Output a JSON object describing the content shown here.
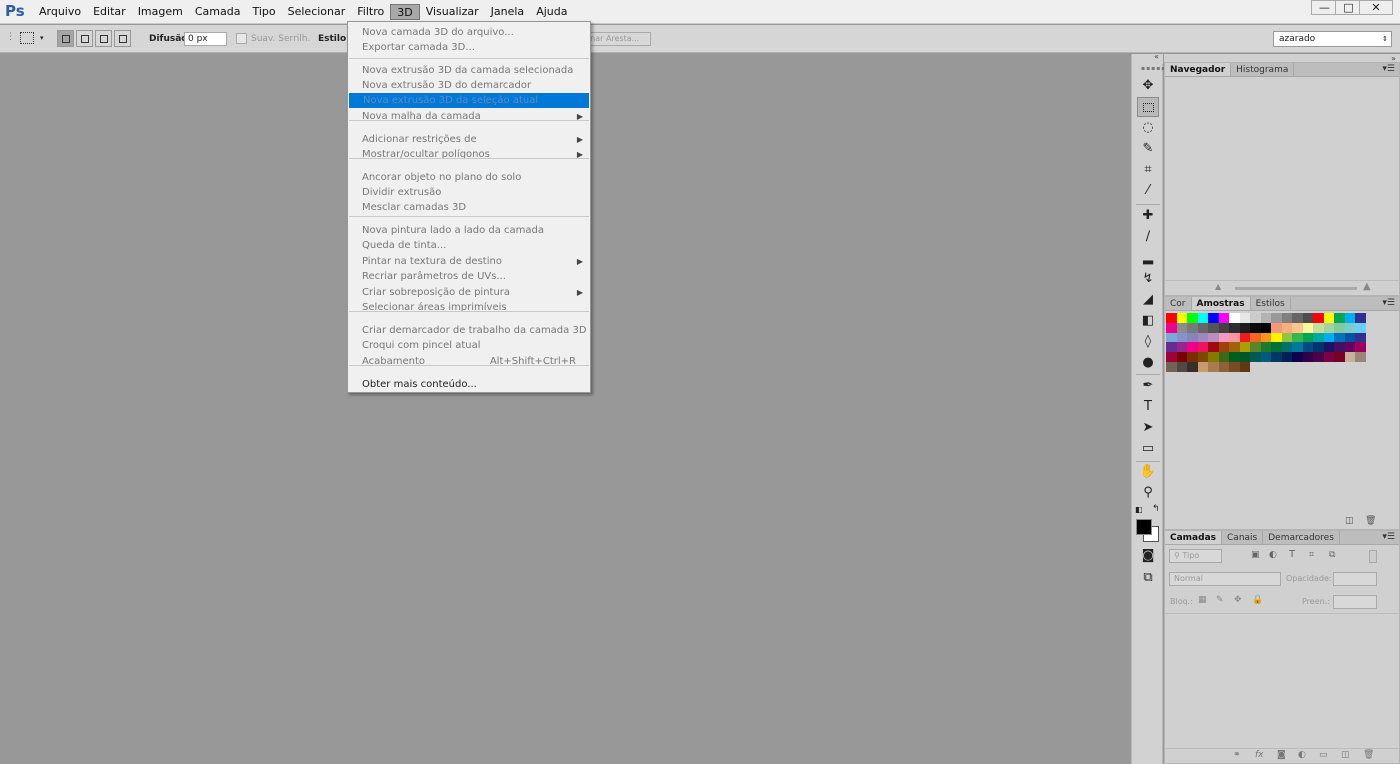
{
  "app": {
    "logo": "Ps"
  },
  "menubar": {
    "items": [
      "Arquivo",
      "Editar",
      "Imagem",
      "Camada",
      "Tipo",
      "Selecionar",
      "Filtro",
      "3D",
      "Visualizar",
      "Janela",
      "Ajuda"
    ],
    "active_index": 7
  },
  "window_controls": {
    "minimize": "—",
    "maximize": "□",
    "close": "✕"
  },
  "options": {
    "feather_label": "Difusão:",
    "feather_value": "0 px",
    "antialias_label": "Suav. Serrilh.",
    "style_label": "Estilo:",
    "refine_edge": "Refinar Aresta...",
    "workspace_value": "azarado"
  },
  "menu_3d": {
    "items": [
      {
        "label": "Nova camada 3D do arquivo...",
        "enabled": false
      },
      {
        "label": "Exportar camada 3D...",
        "enabled": false
      },
      {
        "label": "Nova extrusão 3D da camada selecionada",
        "enabled": false
      },
      {
        "label": "Nova extrusão 3D do demarcador selecionado",
        "enabled": false
      },
      {
        "label": "Nova extrusão 3D da seleção atual",
        "enabled": false,
        "highlighted": true
      },
      {
        "label": "Nova malha da camada",
        "enabled": false,
        "submenu": true
      },
      {
        "label": "Adicionar restrições de",
        "enabled": false,
        "submenu": true
      },
      {
        "label": "Mostrar/ocultar polígonos",
        "enabled": false,
        "submenu": true
      },
      {
        "label": "Ancorar objeto no plano do solo",
        "enabled": false
      },
      {
        "label": "Dividir extrusão",
        "enabled": false
      },
      {
        "label": "Mesclar camadas 3D",
        "enabled": false
      },
      {
        "label": "Nova pintura lado a lado da camada",
        "enabled": false
      },
      {
        "label": "Queda de tinta...",
        "enabled": false
      },
      {
        "label": "Pintar na textura de destino",
        "enabled": false,
        "submenu": true
      },
      {
        "label": "Recriar parâmetros de UVs...",
        "enabled": false
      },
      {
        "label": "Criar sobreposição de pintura",
        "enabled": false,
        "submenu": true
      },
      {
        "label": "Selecionar áreas imprimíveis",
        "enabled": false
      },
      {
        "label": "Criar demarcador de trabalho da camada 3D",
        "enabled": false
      },
      {
        "label": "Croqui com pincel atual",
        "enabled": false
      },
      {
        "label": "Acabamento",
        "enabled": false,
        "shortcut": "Alt+Shift+Ctrl+R"
      },
      {
        "label": "Obter mais conteúdo...",
        "enabled": true
      }
    ]
  },
  "panels": {
    "navigator": {
      "tabs": [
        "Navegador",
        "Histograma"
      ]
    },
    "swatches": {
      "tabs": [
        "Cor",
        "Amostras",
        "Estilos"
      ],
      "colors": [
        "#ff0000",
        "#ffff00",
        "#00ff00",
        "#00ffff",
        "#0000ff",
        "#ff00ff",
        "#ffffff",
        "#e6e6e6",
        "#cccccc",
        "#b3b3b3",
        "#999999",
        "#808080",
        "#666666",
        "#4d4d4d",
        "#ff0000",
        "#ffff00",
        "#00a651",
        "#00aeef",
        "#2e3192",
        "#ec008c",
        "#8c8c8c",
        "#7a7a7a",
        "#666666",
        "#545454",
        "#424242",
        "#2e2e2e",
        "#1c1c1c",
        "#0a0a0a",
        "#000000",
        "#f7977a",
        "#f9ad81",
        "#fdc68a",
        "#fff79a",
        "#c4df9b",
        "#a3d39c",
        "#82ca9d",
        "#7bcdc8",
        "#6ecff6",
        "#7ea7d8",
        "#8493ca",
        "#8882be",
        "#a187be",
        "#bc8dbf",
        "#f49ac2",
        "#f6989d",
        "#ed1c24",
        "#f26522",
        "#f7941d",
        "#fff200",
        "#8dc73f",
        "#39b54a",
        "#00a651",
        "#00a99d",
        "#00aeef",
        "#0072bc",
        "#0054a6",
        "#2e3192",
        "#662d91",
        "#92278f",
        "#ec008c",
        "#ed145b",
        "#9e0b0f",
        "#a0410d",
        "#a3620a",
        "#aba000",
        "#598527",
        "#1a7b30",
        "#007236",
        "#00746b",
        "#0076a3",
        "#004b80",
        "#003471",
        "#1b1464",
        "#440e62",
        "#630460",
        "#9e005d",
        "#9e0039",
        "#790000",
        "#7b2e00",
        "#7d4900",
        "#827b00",
        "#406618",
        "#005e20",
        "#005826",
        "#005952",
        "#005b7f",
        "#003663",
        "#002157",
        "#0d004c",
        "#32004b",
        "#4b0049",
        "#7b0046",
        "#7a0026",
        "#c7b299",
        "#998675",
        "#736357",
        "#534741",
        "#37302a",
        "#c69c6d",
        "#a67c52",
        "#8c6239",
        "#754c24",
        "#603913"
      ]
    },
    "layers": {
      "tabs": [
        "Camadas",
        "Canais",
        "Demarcadores"
      ],
      "kind_label": "Tipo",
      "blend_mode": "Normal",
      "opacity_label": "Opacidade:",
      "lock_label": "Bloq.:",
      "fill_label": "Preen.:"
    }
  }
}
